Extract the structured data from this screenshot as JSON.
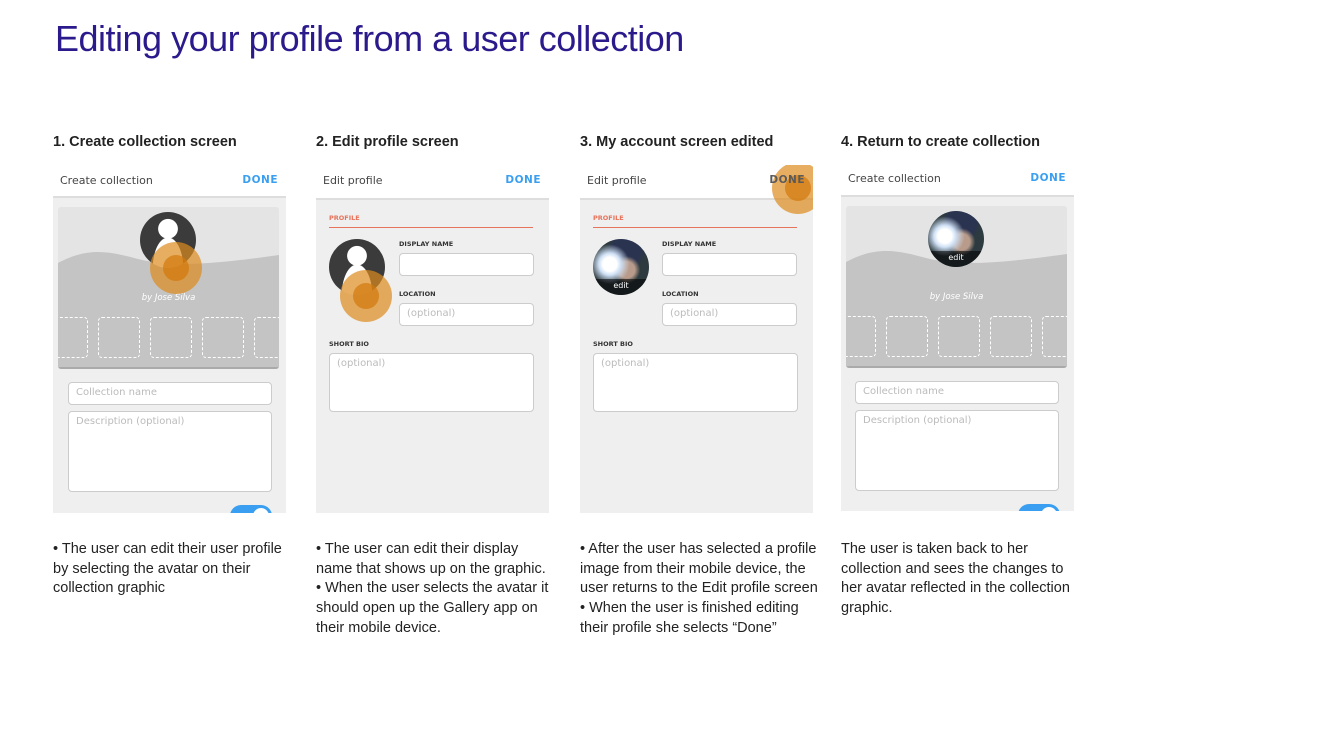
{
  "title": "Editing your profile from a user collection",
  "accent_color": "#3a9ff0",
  "touch_color": "#dd8c1e",
  "steps": [
    {
      "heading": "1. Create collection screen",
      "screen_title": "Create collection",
      "done": "DONE",
      "byline": "by Jose Silva",
      "collection_name_placeholder": "Collection name",
      "description_placeholder": "Description (optional)",
      "description": [
        "• The user can edit their user profile by selecting the avatar on their collection graphic"
      ]
    },
    {
      "heading": "2. Edit profile screen",
      "screen_title": "Edit profile",
      "done": "DONE",
      "section": "PROFILE",
      "display_name_label": "DISPLAY NAME",
      "location_label": "LOCATION",
      "location_placeholder": "(optional)",
      "bio_label": "SHORT BIO",
      "bio_placeholder": "(optional)",
      "description": [
        "• The user can edit their display name that shows up on the graphic.",
        "• When the user selects the avatar it should open up the Gallery app on their mobile device."
      ]
    },
    {
      "heading": "3. My account screen edited",
      "screen_title": "Edit profile",
      "done": "DONE",
      "section": "PROFILE",
      "avatar_edit": "edit",
      "display_name_label": "DISPLAY NAME",
      "location_label": "LOCATION",
      "location_placeholder": "(optional)",
      "bio_label": "SHORT BIO",
      "bio_placeholder": "(optional)",
      "description": [
        "• After the user has selected a profile image from their mobile device, the user returns to the Edit profile screen",
        "• When the user is finished editing their profile she selects “Done”"
      ]
    },
    {
      "heading": "4. Return to create collection",
      "screen_title": "Create collection",
      "done": "DONE",
      "avatar_edit": "edit",
      "byline": "by Jose Silva",
      "collection_name_placeholder": "Collection name",
      "description_placeholder": "Description (optional)",
      "description": [
        "The user is taken back to her collection and sees the changes to her avatar reflected in the collection graphic."
      ]
    }
  ]
}
